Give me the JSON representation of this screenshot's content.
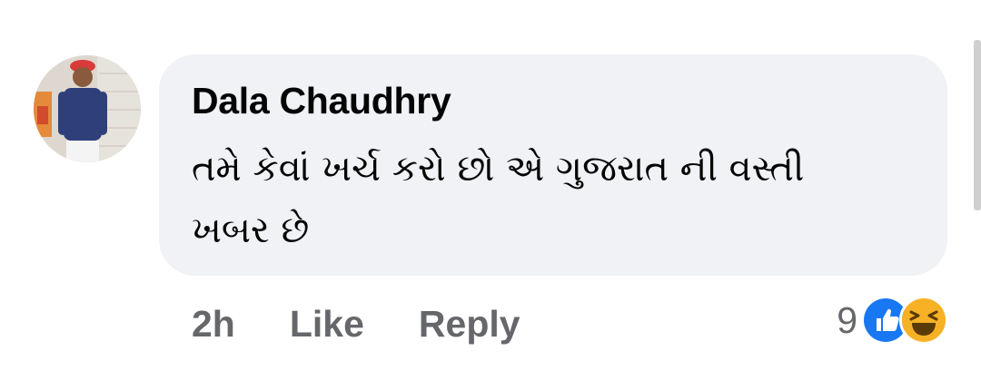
{
  "comment": {
    "author": "Dala Chaudhry",
    "text": "તમે કેવાં ખર્ચ કરો છો એ ગુજરાત ની વસ્તી ખબર છે",
    "time": "2h",
    "like_label": "Like",
    "reply_label": "Reply",
    "reaction_count": "9",
    "reactions": [
      "like-icon",
      "haha-icon"
    ]
  },
  "colors": {
    "bubble": "#f0f2f5",
    "muted_text": "#65676b",
    "primary_text": "#050505",
    "like_blue": "#1877f2",
    "haha_yellow": "#f7b125"
  }
}
